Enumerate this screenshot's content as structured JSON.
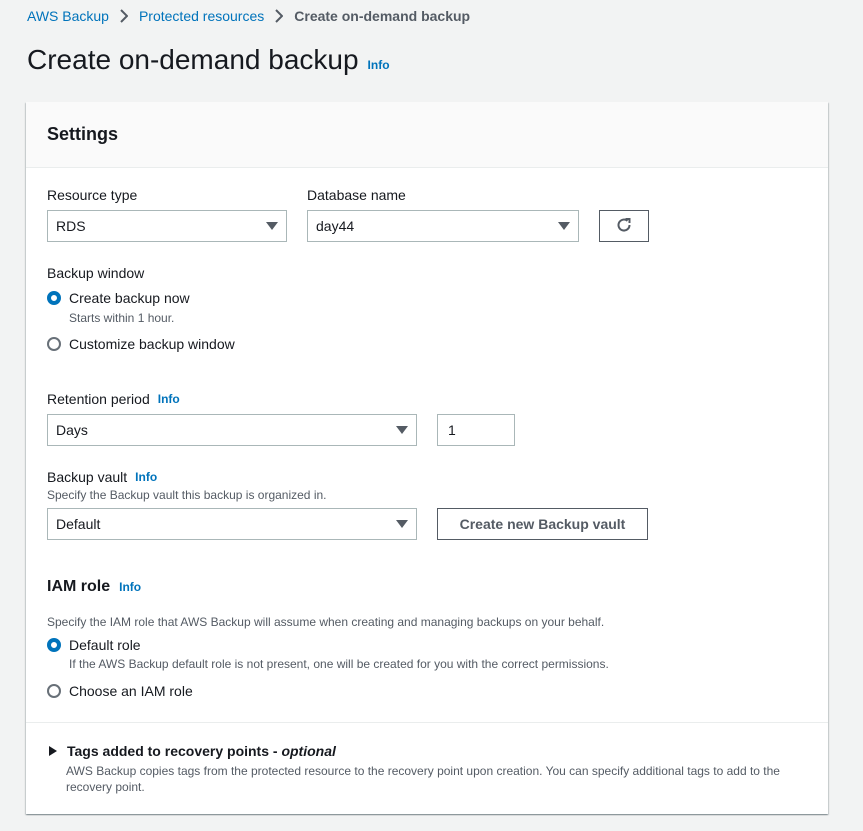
{
  "breadcrumb": {
    "items": [
      "AWS Backup",
      "Protected resources"
    ],
    "current": "Create on-demand backup"
  },
  "page": {
    "title": "Create on-demand backup",
    "info": "Info"
  },
  "settings": {
    "title": "Settings",
    "resource_type": {
      "label": "Resource type",
      "value": "RDS"
    },
    "database_name": {
      "label": "Database name",
      "value": "day44"
    },
    "refresh_icon": "refresh-icon",
    "backup_window": {
      "label": "Backup window",
      "options": [
        {
          "label": "Create backup now",
          "desc": "Starts within 1 hour.",
          "checked": true
        },
        {
          "label": "Customize backup window",
          "checked": false
        }
      ]
    },
    "retention": {
      "label": "Retention period",
      "info": "Info",
      "unit": "Days",
      "value": "1"
    },
    "vault": {
      "label": "Backup vault",
      "info": "Info",
      "desc": "Specify the Backup vault this backup is organized in.",
      "value": "Default",
      "create_button": "Create new Backup vault"
    },
    "iam": {
      "title": "IAM role",
      "info": "Info",
      "desc": "Specify the IAM role that AWS Backup will assume when creating and managing backups on your behalf.",
      "options": [
        {
          "label": "Default role",
          "desc": "If the AWS Backup default role is not present, one will be created for you with the correct permissions.",
          "checked": true
        },
        {
          "label": "Choose an IAM role",
          "checked": false
        }
      ]
    },
    "tags": {
      "title": "Tags added to recovery points -",
      "optional": "optional",
      "desc_line1": "AWS Backup copies tags from the protected resource to the recovery point upon creation. You can specify additional tags to add to the",
      "desc_line2": "recovery point."
    }
  },
  "colors": {
    "link": "#0073bb",
    "text": "#16191f",
    "muted": "#545b64",
    "background": "#f2f3f3"
  }
}
